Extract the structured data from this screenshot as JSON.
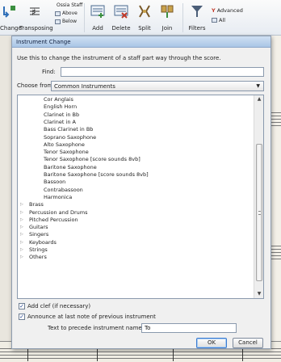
{
  "ribbon": {
    "change_label": "Change",
    "transposing_label": "Transposing",
    "ossia_staff_label": "Ossia Staff",
    "above_label": "Above",
    "below_label": "Below",
    "add_label": "Add",
    "delete_label": "Delete",
    "split_label": "Split",
    "join_label": "Join",
    "filters_label": "Filters",
    "advanced_label": "Advanced",
    "all_label": "All"
  },
  "dialog": {
    "title": "Instrument Change",
    "description": "Use this to change the instrument of a staff part way through the score.",
    "find_label": "Find:",
    "find_value": "",
    "choose_label": "Choose from:",
    "choose_value": "Common Instruments",
    "instruments": [
      "Cor Anglais",
      "English Horn",
      "Clarinet in Bb",
      "Clarinet in A",
      "Bass Clarinet in Bb",
      "Soprano Saxophone",
      "Alto Saxophone",
      "Tenor Saxophone",
      "Tenor Saxophone [score sounds 8vb]",
      "Baritone Saxophone",
      "Baritone Saxophone [score sounds 8vb]",
      "Bassoon",
      "Contrabassoon",
      "Harmonica"
    ],
    "categories": [
      "Brass",
      "Percussion and Drums",
      "Pitched Percussion",
      "Guitars",
      "Singers",
      "Keyboards",
      "Strings",
      "Others"
    ],
    "add_clef_label": "Add clef (if necessary)",
    "add_clef_checked": true,
    "announce_label": "Announce at last note of previous instrument",
    "announce_checked": true,
    "precede_label": "Text to precede instrument name:",
    "precede_value": "To",
    "ok_label": "OK",
    "cancel_label": "Cancel"
  },
  "colors": {
    "ribbon_icon_green": "#3b8f3f",
    "ribbon_icon_blue": "#2f6fb8",
    "filter_icon_red": "#c23a2a",
    "titlebar": "#b9d1ec"
  }
}
